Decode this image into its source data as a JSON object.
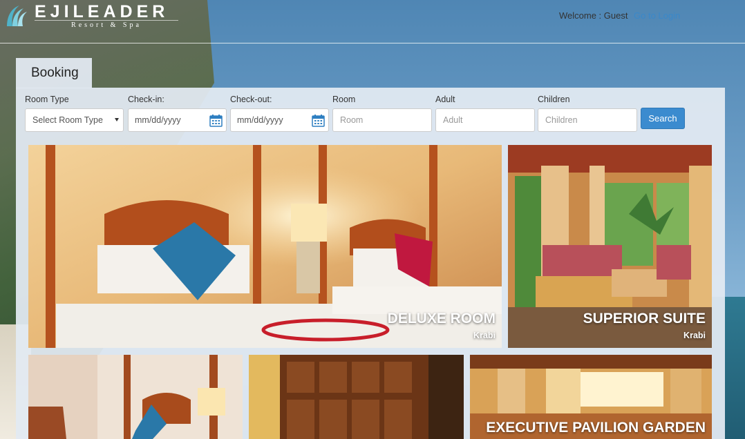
{
  "header": {
    "brand_name": "EJILEADER",
    "brand_sub": "Resort & Spa",
    "welcome_text": "Welcome : Guest",
    "login_link": "Go to Login"
  },
  "booking": {
    "tab_label": "Booking",
    "fields": {
      "room_type": {
        "label": "Room Type",
        "value": "Select Room Type"
      },
      "check_in": {
        "label": "Check-in:",
        "value": "mm/dd/yyyy"
      },
      "check_out": {
        "label": "Check-out:",
        "value": "mm/dd/yyyy"
      },
      "room": {
        "label": "Room",
        "placeholder": "Room"
      },
      "adult": {
        "label": "Adult",
        "placeholder": "Adult"
      },
      "children": {
        "label": "Children",
        "placeholder": "Children"
      }
    },
    "search_label": "Search"
  },
  "rooms": [
    {
      "title": "DELUXE ROOM",
      "location": "Krabi"
    },
    {
      "title": "SUPERIOR SUITE",
      "location": "Krabi"
    },
    {
      "title": "",
      "location": ""
    },
    {
      "title": "",
      "location": ""
    },
    {
      "title": "EXECUTIVE PAVILION GARDEN",
      "location": ""
    }
  ],
  "colors": {
    "accent": "#3b8bcf",
    "link": "#3a88c9",
    "panel": "#e2eaf2"
  }
}
